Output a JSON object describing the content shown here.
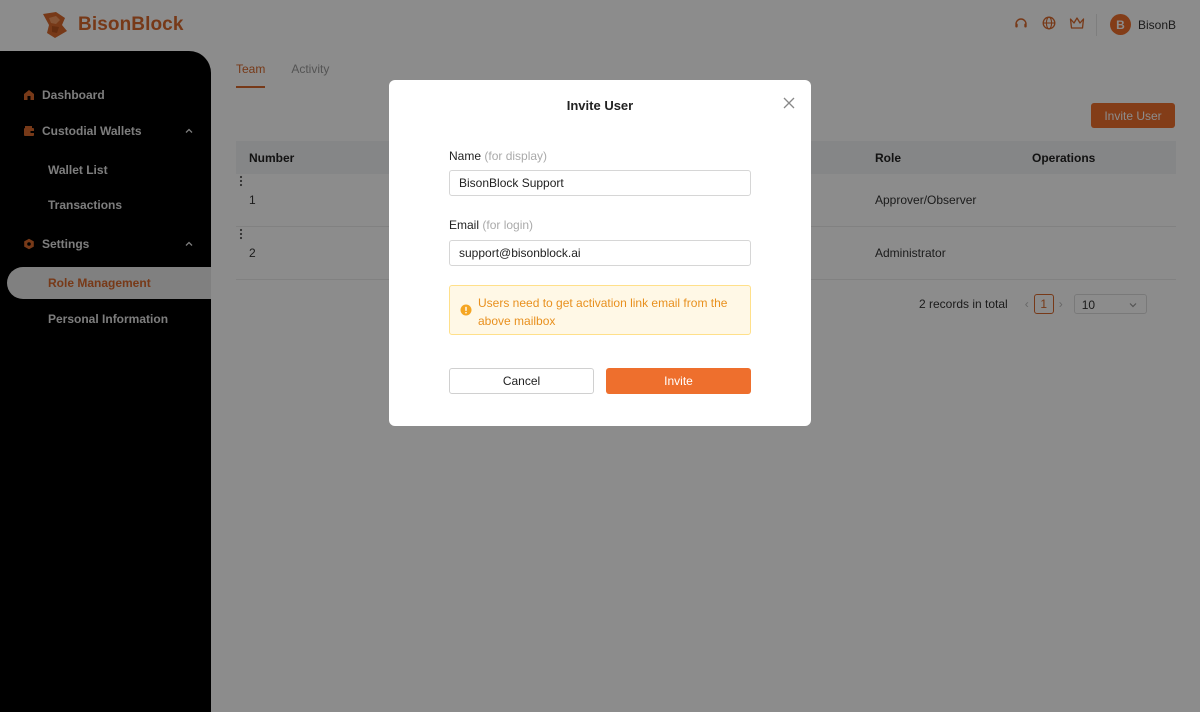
{
  "brand": {
    "name": "BisonBlock",
    "color": "#d9692c",
    "logo_icon": "bison-logo-icon"
  },
  "header": {
    "icons": [
      "support-headset-icon",
      "globe-icon",
      "crown-icon"
    ],
    "avatar_initial": "B",
    "username": "BisonB"
  },
  "sidebar": {
    "items": [
      {
        "label": "Dashboard",
        "icon": "home-icon"
      },
      {
        "label": "Custodial Wallets",
        "icon": "wallet-icon",
        "expanded": true,
        "children": [
          {
            "label": "Wallet List"
          },
          {
            "label": "Transactions"
          }
        ]
      },
      {
        "label": "Settings",
        "icon": "settings-icon",
        "expanded": true,
        "children": [
          {
            "label": "Role Management",
            "active": true
          },
          {
            "label": "Personal Information"
          }
        ]
      }
    ]
  },
  "main": {
    "tabs": [
      {
        "label": "Team",
        "active": true
      },
      {
        "label": "Activity"
      }
    ],
    "invite_button": "Invite User",
    "table": {
      "columns": {
        "number": "Number",
        "role": "Role",
        "operations": "Operations"
      },
      "rows": [
        {
          "number": "1",
          "role": "Approver/Observer"
        },
        {
          "number": "2",
          "role": "Administrator"
        }
      ]
    },
    "pagination": {
      "total": "2 records in total",
      "current_page": "1",
      "page_size": "10"
    }
  },
  "modal": {
    "title": "Invite User",
    "name_label": "Name",
    "name_hint": "(for display)",
    "name_value": "BisonBlock Support",
    "email_label": "Email",
    "email_hint": "(for login)",
    "email_value": "support@bisonblock.ai",
    "notice": "Users need to get activation link email from the above mailbox",
    "cancel_label": "Cancel",
    "invite_label": "Invite"
  },
  "colors": {
    "accent": "#ee6f2d",
    "warning_text": "#e8901e",
    "warning_bg": "#fff8e6"
  }
}
